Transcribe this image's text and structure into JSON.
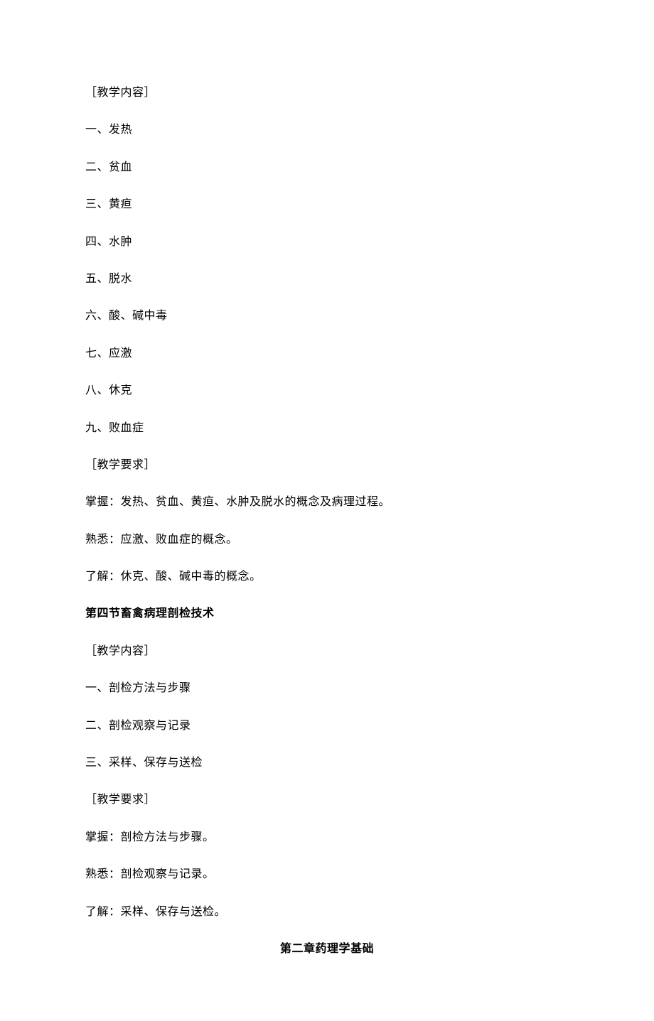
{
  "sections": {
    "header1": "［教学内容］",
    "item1": "一、发热",
    "item2": "二、贫血",
    "item3": "三、黄疸",
    "item4": "四、水肿",
    "item5": "五、脱水",
    "item6": "六、酸、碱中毒",
    "item7": "七、应激",
    "item8": "八、休克",
    "item9": "九、败血症",
    "header2": "［教学要求］",
    "req1": "掌握：发热、贫血、黄疸、水肿及脱水的概念及病理过程。",
    "req2": "熟悉：应激、败血症的概念。",
    "req3": "了解：休克、酸、碱中毒的概念。",
    "sectionTitle1": "第四节畜禽病理剖检技术",
    "header3": "［教学内容］",
    "item10": "一、剖检方法与步骤",
    "item11": "二、剖检观察与记录",
    "item12": "三、采样、保存与送检",
    "header4": "［教学要求］",
    "req4": "掌握：剖检方法与步骤。",
    "req5": "熟悉：剖检观察与记录。",
    "req6": "了解：采样、保存与送检。",
    "chapterTitle": "第二章药理学基础"
  }
}
